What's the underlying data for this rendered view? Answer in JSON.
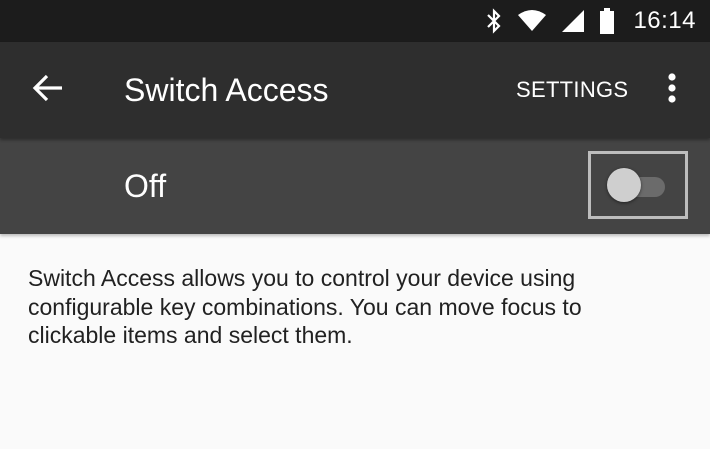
{
  "status_bar": {
    "icons": [
      "bluetooth-icon",
      "wifi-icon",
      "cell-signal-icon",
      "battery-icon"
    ],
    "time": "16:14"
  },
  "app_bar": {
    "title": "Switch Access",
    "back_icon": "arrow-back-icon",
    "settings_label": "SETTINGS",
    "overflow_icon": "more-vert-icon"
  },
  "master_switch": {
    "label": "Off",
    "checked": false
  },
  "content": {
    "description": "Switch Access allows you to control your device using configurable key combinations. You can move focus to clickable items and select them."
  },
  "colors": {
    "status_bar_bg": "#1c1c1c",
    "app_bar_bg": "#2e2e2e",
    "master_bar_bg": "#444444",
    "page_bg": "#fafafa",
    "text_dark": "#212121",
    "focus_outline": "#bdbdbd"
  }
}
